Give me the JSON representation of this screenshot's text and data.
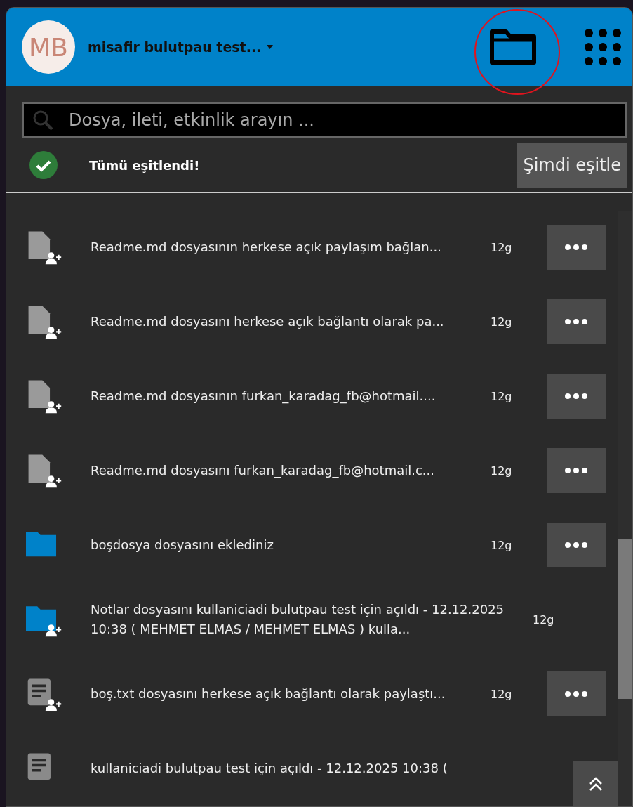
{
  "header": {
    "avatar_initials": "MB",
    "account_name": "misafir bulutpau test..."
  },
  "search": {
    "placeholder": "Dosya, ileti, etkinlik arayın ..."
  },
  "sync": {
    "status": "Tümü eşitlendi!",
    "button": "Şimdi eşitle"
  },
  "activities": [
    {
      "kind": "file",
      "shared": true,
      "text": "Readme.md dosyasının herkese açık paylaşım bağlan...",
      "time": "12g",
      "menu": true
    },
    {
      "kind": "file",
      "shared": true,
      "text": "Readme.md dosyasını herkese açık bağlantı olarak pa...",
      "time": "12g",
      "menu": true
    },
    {
      "kind": "file",
      "shared": true,
      "text": "Readme.md dosyasının furkan_karadag_fb@hotmail....",
      "time": "12g",
      "menu": true
    },
    {
      "kind": "file",
      "shared": true,
      "text": "Readme.md dosyasını furkan_karadag_fb@hotmail.c...",
      "time": "12g",
      "menu": true
    },
    {
      "kind": "folder",
      "shared": false,
      "text": "boşdosya dosyasını eklediniz",
      "time": "12g",
      "menu": true
    },
    {
      "kind": "folder",
      "shared": true,
      "text": "Notlar dosyasını kullaniciadi bulutpau test için açıldı - 12.12.2025 10:38 ( MEHMET ELMAS / MEHMET ELMAS ) kulla...",
      "time": "12g",
      "menu": false
    },
    {
      "kind": "text",
      "shared": true,
      "text": "boş.txt dosyasını herkese açık bağlantı olarak paylaştı...",
      "time": "12g",
      "menu": true
    },
    {
      "kind": "text",
      "shared": false,
      "text": "kullaniciadi bulutpau test için açıldı - 12.12.2025 10:38 (",
      "menu": false
    }
  ]
}
